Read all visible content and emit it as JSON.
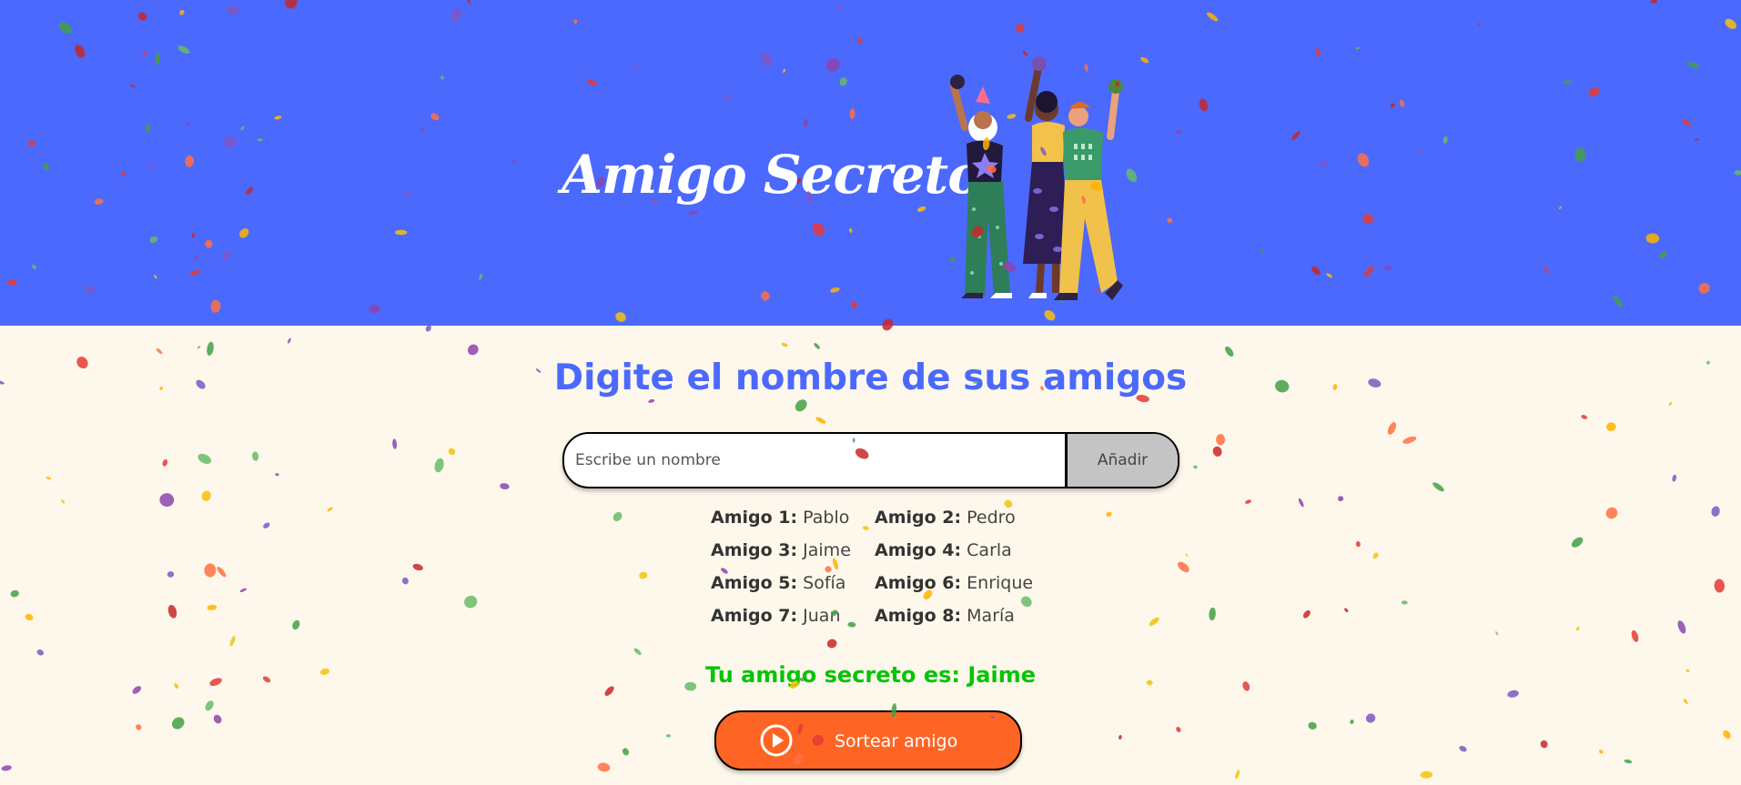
{
  "header": {
    "title": "Amigo Secreto"
  },
  "main": {
    "subtitle": "Digite el nombre de sus amigos",
    "input_placeholder": "Escribe un nombre",
    "add_button": "Añadir",
    "friends": [
      {
        "label": "Amigo 1:",
        "name": "Pablo"
      },
      {
        "label": "Amigo 2:",
        "name": "Pedro"
      },
      {
        "label": "Amigo 3:",
        "name": "Jaime"
      },
      {
        "label": "Amigo 4:",
        "name": "Carla"
      },
      {
        "label": "Amigo 5:",
        "name": "Sofía"
      },
      {
        "label": "Amigo 6:",
        "name": "Enrique"
      },
      {
        "label": "Amigo 7:",
        "name": "Juan"
      },
      {
        "label": "Amigo 8:",
        "name": "María"
      }
    ],
    "result": "Tu amigo secreto es: Jaime",
    "draw_button": "Sortear amigo",
    "draw_icon": "play-circle-icon"
  },
  "colors": {
    "header_bg": "#4b69fd",
    "page_bg": "#fdf8eb",
    "accent": "#4b69fd",
    "result": "#06c406",
    "draw_button": "#fe6524",
    "add_button": "#c4c4c4"
  }
}
